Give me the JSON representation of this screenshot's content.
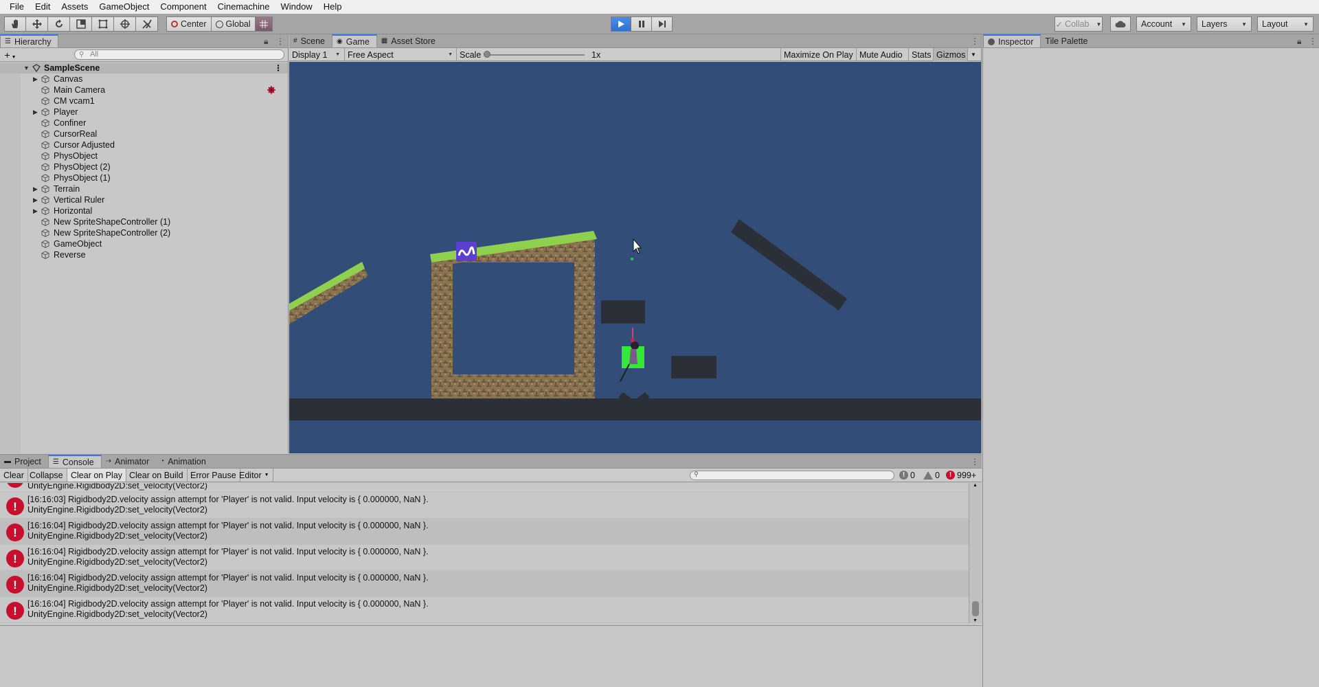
{
  "menubar": {
    "items": [
      "File",
      "Edit",
      "Assets",
      "GameObject",
      "Component",
      "Cinemachine",
      "Window",
      "Help"
    ]
  },
  "toolbar": {
    "pivot_label": "Center",
    "space_label": "Global",
    "collab_label": "Collab",
    "account_label": "Account",
    "layers_label": "Layers",
    "layout_label": "Layout",
    "play_state": "playing",
    "accent_color": "#3a7ae0"
  },
  "hierarchy": {
    "tab_label": "Hierarchy",
    "add_label": "+",
    "search_placeholder": "All",
    "scene_name": "SampleScene",
    "items": [
      {
        "label": "Canvas",
        "expandable": true
      },
      {
        "label": "Main Camera",
        "expandable": false,
        "badge": "camera-gizmo-icon"
      },
      {
        "label": "CM vcam1",
        "expandable": false
      },
      {
        "label": "Player",
        "expandable": true
      },
      {
        "label": "Confiner",
        "expandable": false
      },
      {
        "label": "CursorReal",
        "expandable": false
      },
      {
        "label": "Cursor Adjusted",
        "expandable": false
      },
      {
        "label": "PhysObject",
        "expandable": false
      },
      {
        "label": "PhysObject (2)",
        "expandable": false
      },
      {
        "label": "PhysObject (1)",
        "expandable": false
      },
      {
        "label": "Terrain",
        "expandable": true
      },
      {
        "label": "Vertical Ruler",
        "expandable": true
      },
      {
        "label": "Horizontal",
        "expandable": true
      },
      {
        "label": "New SpriteShapeController (1)",
        "expandable": false
      },
      {
        "label": "New SpriteShapeController (2)",
        "expandable": false
      },
      {
        "label": "GameObject",
        "expandable": false
      },
      {
        "label": "Reverse",
        "expandable": false
      }
    ]
  },
  "gameview": {
    "tabs": [
      {
        "label": "Scene",
        "icon": "scene-icon",
        "active": false
      },
      {
        "label": "Game",
        "icon": "game-icon",
        "active": true
      },
      {
        "label": "Asset Store",
        "icon": "asset-store-icon",
        "active": false
      }
    ],
    "display_label": "Display 1",
    "aspect_label": "Free Aspect",
    "scale_label": "Scale",
    "scale_value": "1x",
    "maximize_label": "Maximize On Play",
    "mute_label": "Mute Audio",
    "stats_label": "Stats",
    "gizmos_label": "Gizmos",
    "background_color": "#324d77",
    "platform_color": "#2b2f38",
    "grass_color": "#8fd14f",
    "dirt_color": "#8a7350"
  },
  "inspector": {
    "tabs": [
      {
        "label": "Inspector",
        "icon": "info-icon",
        "active": true
      },
      {
        "label": "Tile Palette",
        "icon": "",
        "active": false
      }
    ]
  },
  "console": {
    "tabs": [
      {
        "label": "Project",
        "icon": "folder-icon",
        "active": false
      },
      {
        "label": "Console",
        "icon": "console-icon",
        "active": true
      },
      {
        "label": "Animator",
        "icon": "animator-icon",
        "active": false
      },
      {
        "label": "Animation",
        "icon": "animation-icon",
        "active": false
      }
    ],
    "buttons": {
      "clear": "Clear",
      "collapse": "Collapse",
      "clear_on_play": "Clear on Play",
      "clear_on_build": "Clear on Build",
      "error_pause": "Error Pause",
      "editor": "Editor"
    },
    "counts": {
      "info": "0",
      "warning": "0",
      "error": "999+"
    },
    "error_color": "#c8102e",
    "partial_line": "UnityEngine.Rigidbody2D:set_velocity(Vector2)",
    "logs": [
      {
        "line1": "[16:16:03] Rigidbody2D.velocity assign attempt for 'Player' is not valid. Input velocity is { 0.000000, NaN }.",
        "line2": "UnityEngine.Rigidbody2D:set_velocity(Vector2)"
      },
      {
        "line1": "[16:16:04] Rigidbody2D.velocity assign attempt for 'Player' is not valid. Input velocity is { 0.000000, NaN }.",
        "line2": "UnityEngine.Rigidbody2D:set_velocity(Vector2)"
      },
      {
        "line1": "[16:16:04] Rigidbody2D.velocity assign attempt for 'Player' is not valid. Input velocity is { 0.000000, NaN }.",
        "line2": "UnityEngine.Rigidbody2D:set_velocity(Vector2)"
      },
      {
        "line1": "[16:16:04] Rigidbody2D.velocity assign attempt for 'Player' is not valid. Input velocity is { 0.000000, NaN }.",
        "line2": "UnityEngine.Rigidbody2D:set_velocity(Vector2)"
      },
      {
        "line1": "[16:16:04] Rigidbody2D.velocity assign attempt for 'Player' is not valid. Input velocity is { 0.000000, NaN }.",
        "line2": "UnityEngine.Rigidbody2D:set_velocity(Vector2)"
      }
    ]
  }
}
